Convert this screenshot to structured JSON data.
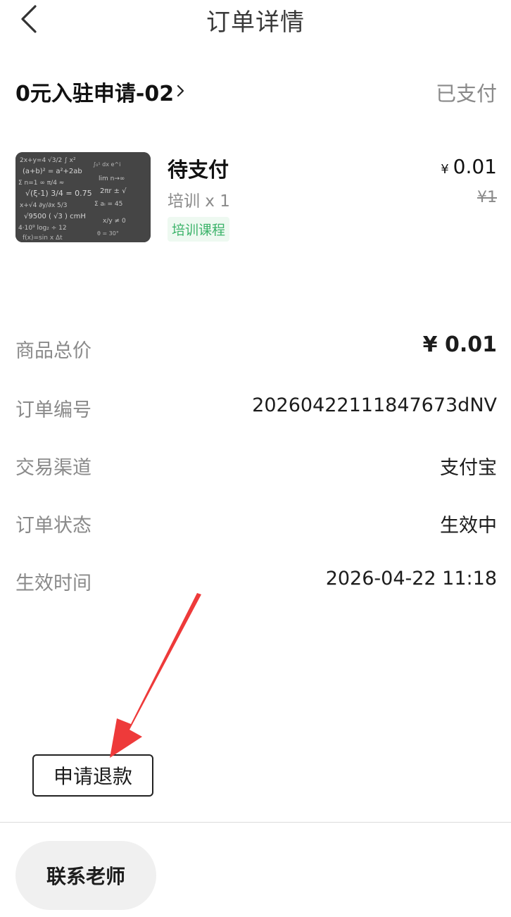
{
  "header": {
    "title": "订单详情",
    "back_icon": "chevron-left-icon"
  },
  "order": {
    "name": "0元入驻申请-02",
    "pay_status": "已支付"
  },
  "product": {
    "image": "blackboard-math-formulas",
    "title": "待支付",
    "subtitle": "培训 x 1",
    "tag": "培训课程",
    "price_symbol": "¥",
    "price": "0.01",
    "original_price": "¥1"
  },
  "details": {
    "total_label": "商品总价",
    "total_value": "¥ 0.01",
    "order_no_label": "订单编号",
    "order_no_value": "20260422111847673dNV",
    "channel_label": "交易渠道",
    "channel_value": "支付宝",
    "status_label": "订单状态",
    "status_value": "生效中",
    "time_label": "生效时间",
    "time_value": "2026-04-22 11:18"
  },
  "actions": {
    "refund_label": "申请退款",
    "contact_label": "联系老师"
  },
  "colors": {
    "annotation_arrow": "#ee3a3a",
    "tag_green": "#3cb36a",
    "muted_text": "#8a8a8a"
  }
}
